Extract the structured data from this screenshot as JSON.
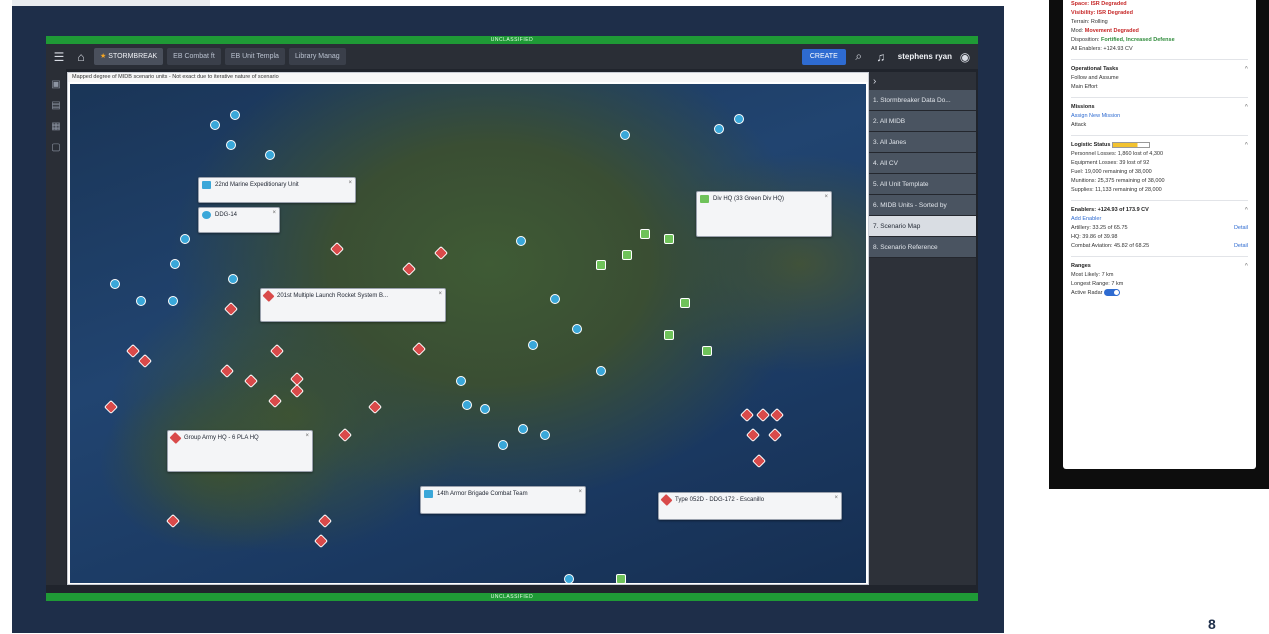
{
  "app": {
    "classification_top": "UNCLASSIFIED",
    "classification_bottom": "UNCLASSIFIED",
    "tabs": [
      {
        "label": "STORMBREAK",
        "active": true
      },
      {
        "label": "EB Combat ft",
        "active": false
      },
      {
        "label": "EB Unit Templa",
        "active": false
      },
      {
        "label": "Library Manag",
        "active": false
      }
    ],
    "create_label": "CREATE",
    "user_name": "stephens ryan",
    "map_note": "Mapped degree of MIDB scenario units - Not exact due to iterative nature of scenario"
  },
  "callouts": [
    {
      "label": "22nd Marine Expeditionary Unit",
      "kind": "blue"
    },
    {
      "label": "DDG-14",
      "kind": "blue"
    },
    {
      "label": "Div HQ (33 Green Div HQ)",
      "kind": "green"
    },
    {
      "label": "201st Multiple Launch Rocket System B...",
      "kind": "red"
    },
    {
      "label": "Group Army HQ - 6 PLA HQ",
      "kind": "red"
    },
    {
      "label": "14th Armor Brigade Combat Team",
      "kind": "blue"
    },
    {
      "label": "Type 052D - DDG-172 - Escanillo",
      "kind": "red"
    }
  ],
  "nav": {
    "items": [
      "1. Stormbreaker Data Do...",
      "2. All MIDB",
      "3. All Janes",
      "4. All CV",
      "5. All Unit Template",
      "6. MIDB Units - Sorted by",
      "7. Scenario Map",
      "8. Scenario Reference"
    ],
    "selected_index": 6
  },
  "panel": {
    "lines_top": [
      "Space: ISR Degraded",
      "Visibility: ISR Degraded",
      "Terrain: Rolling"
    ],
    "mod_label": "Mod:",
    "mod_value": "Movement Degraded",
    "disposition_label": "Disposition:",
    "disposition_value": "Fortified, Increased Defense",
    "all_enablers": "All Enablers: +124.93 CV",
    "operational_tasks": {
      "title": "Operational Tasks",
      "items": [
        "Follow and Assume",
        "Main Effort"
      ]
    },
    "missions": {
      "title": "Missions",
      "assign": "Assign New Mission",
      "item": "Attack"
    },
    "logistics": {
      "title": "Logistic Status",
      "fill": 0.68,
      "rows": [
        "Personnel Losses: 1,860 lost of 4,300",
        "Equipment Losses: 39 lost of 92",
        "Fuel: 19,000 remaining of 38,000",
        "Munitions: 25,375 remaining of 38,000",
        "Supplies: 11,133 remaining of 28,000"
      ]
    },
    "enablers": {
      "title": "Enablers: +124.93 of 173.9 CV",
      "add": "Add Enabler",
      "rows": [
        {
          "label": "Artillery: 33.25 of 65.75",
          "detail": "Detail"
        },
        {
          "label": "HQ: 39.86 of 39.98",
          "detail": ""
        },
        {
          "label": "Combat Aviation: 45.82 of 68.25",
          "detail": "Detail"
        }
      ]
    },
    "ranges": {
      "title": "Ranges",
      "rows": [
        "Most Likely: 7 km",
        "Longest Range: 7 km"
      ],
      "active_radar": "Active Radar",
      "active_radar_on": true
    }
  },
  "page_number": "8",
  "colors": {
    "accent": "#2e6bd1",
    "classification": "#1f9a36",
    "slide_bg": "#1e2e49"
  }
}
